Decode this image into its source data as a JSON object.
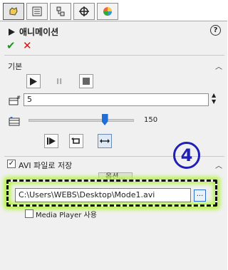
{
  "tabs": [
    {
      "icon": "feature-manager-icon",
      "active": true
    },
    {
      "icon": "property-manager-icon",
      "active": false
    },
    {
      "icon": "configuration-manager-icon",
      "active": false
    },
    {
      "icon": "dimxpert-icon",
      "active": false
    },
    {
      "icon": "display-manager-icon",
      "active": false
    }
  ],
  "header": {
    "title": "애니메이션",
    "help": "?",
    "ok": "✔",
    "cancel": "✕"
  },
  "basic": {
    "label": "기본",
    "collapse_icon": "chevron-up-icon",
    "frames_value": "5",
    "slider_value": "150",
    "slider_fraction": 0.72
  },
  "avi": {
    "checked": true,
    "label": "AVI 파일로 저장",
    "options_button": "옵션...",
    "path": "C:\\Users\\WEBS\\Desktop\\Mode1.avi",
    "browse_label": "...",
    "media_player_label": "Media Player 사용",
    "media_player_checked": false
  },
  "annotation": {
    "number": "4",
    "color": "#1f1fb8",
    "highlight": "#b7f34a"
  }
}
